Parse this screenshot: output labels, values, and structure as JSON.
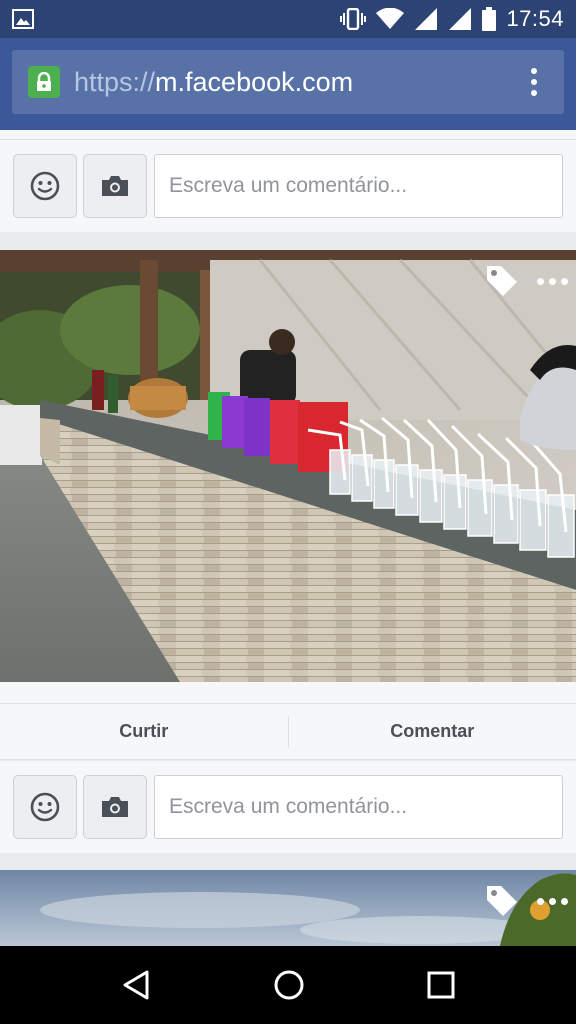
{
  "status_bar": {
    "time": "17:54",
    "icons": [
      "image-notification-icon",
      "vibrate-icon",
      "wifi-icon",
      "signal-icon",
      "signal-icon",
      "battery-icon"
    ]
  },
  "browser": {
    "url_scheme": "https://",
    "url_host": "m.facebook.com",
    "lock_icon": "lock-icon",
    "menu_icon": "overflow-menu-icon"
  },
  "comment_box_1": {
    "placeholder": "Escreva um comentário..."
  },
  "post_photo": {
    "description_icons": [
      "tag-icon",
      "more-icon"
    ]
  },
  "post_actions": {
    "like_label": "Curtir",
    "comment_label": "Comentar"
  },
  "comment_box_2": {
    "placeholder": "Escreva um comentário..."
  },
  "nav": {
    "icons": [
      "back-icon",
      "home-icon",
      "recents-icon"
    ]
  },
  "colors": {
    "facebook_blue": "#3b5998",
    "status_bar": "#2d4373",
    "lock_green": "#4caf50"
  }
}
